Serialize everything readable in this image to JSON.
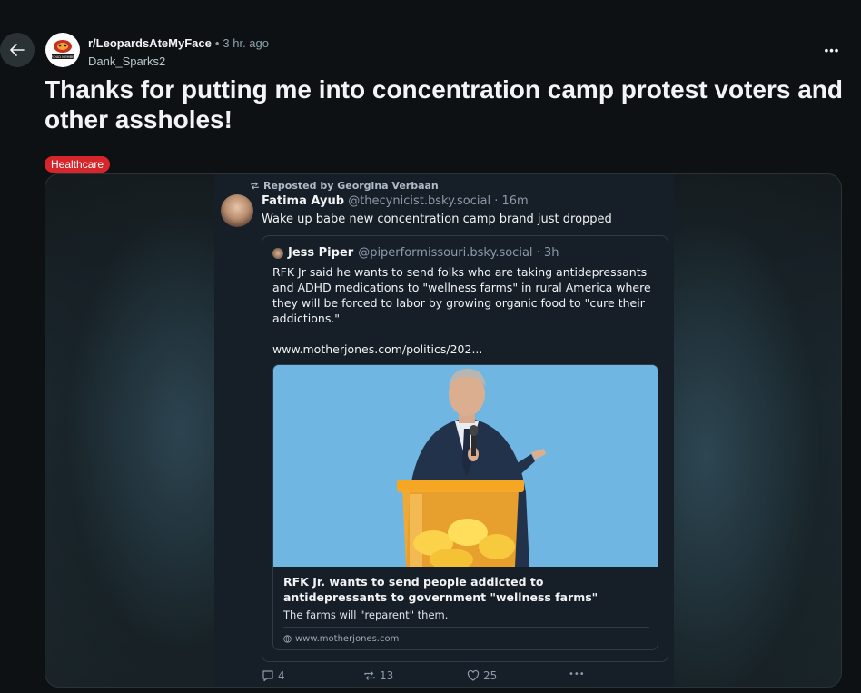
{
  "post": {
    "subreddit": "r/LeopardsAteMyFace",
    "separator": "•",
    "time": "3 hr. ago",
    "author": "Dank_Sparks2",
    "title": "Thanks for putting me into concentration camp protest voters and other assholes!",
    "flair": "Healthcare",
    "more_label": "•••",
    "avatar_badge": "PROUD MEMBER"
  },
  "bluesky": {
    "repost_label": "Reposted by Georgina Verbaan",
    "author_name": "Fatima Ayub",
    "author_handle": "@thecynicist.bsky.social · 16m",
    "text": "Wake up babe new concentration camp brand just dropped",
    "quote": {
      "name": "Jess Piper",
      "handle": "@piperformissouri.bsky.social · 3h",
      "body": "RFK Jr said he wants to send folks who are taking antidepressants and ADHD medications to \"wellness farms\" in rural America where they will be forced to labor by growing organic food to \"cure their addictions.\"",
      "link": "www.motherjones.com/politics/202...",
      "card": {
        "title": "RFK Jr. wants to send people addicted to antidepressants to government \"wellness farms\"",
        "description": "The farms will \"reparent\" them.",
        "domain": "www.motherjones.com"
      }
    },
    "actions": {
      "replies": "4",
      "reposts": "13",
      "likes": "25",
      "more": "•••"
    }
  },
  "icons": [
    "back-arrow-icon",
    "more-icon",
    "repost-icon",
    "reply-icon",
    "like-icon",
    "globe-icon"
  ],
  "colors": {
    "background": "#0e1113",
    "flair": "#d6262c",
    "bluesky_bg": "#161e27",
    "card_image_sky": "#6fb6e3"
  }
}
